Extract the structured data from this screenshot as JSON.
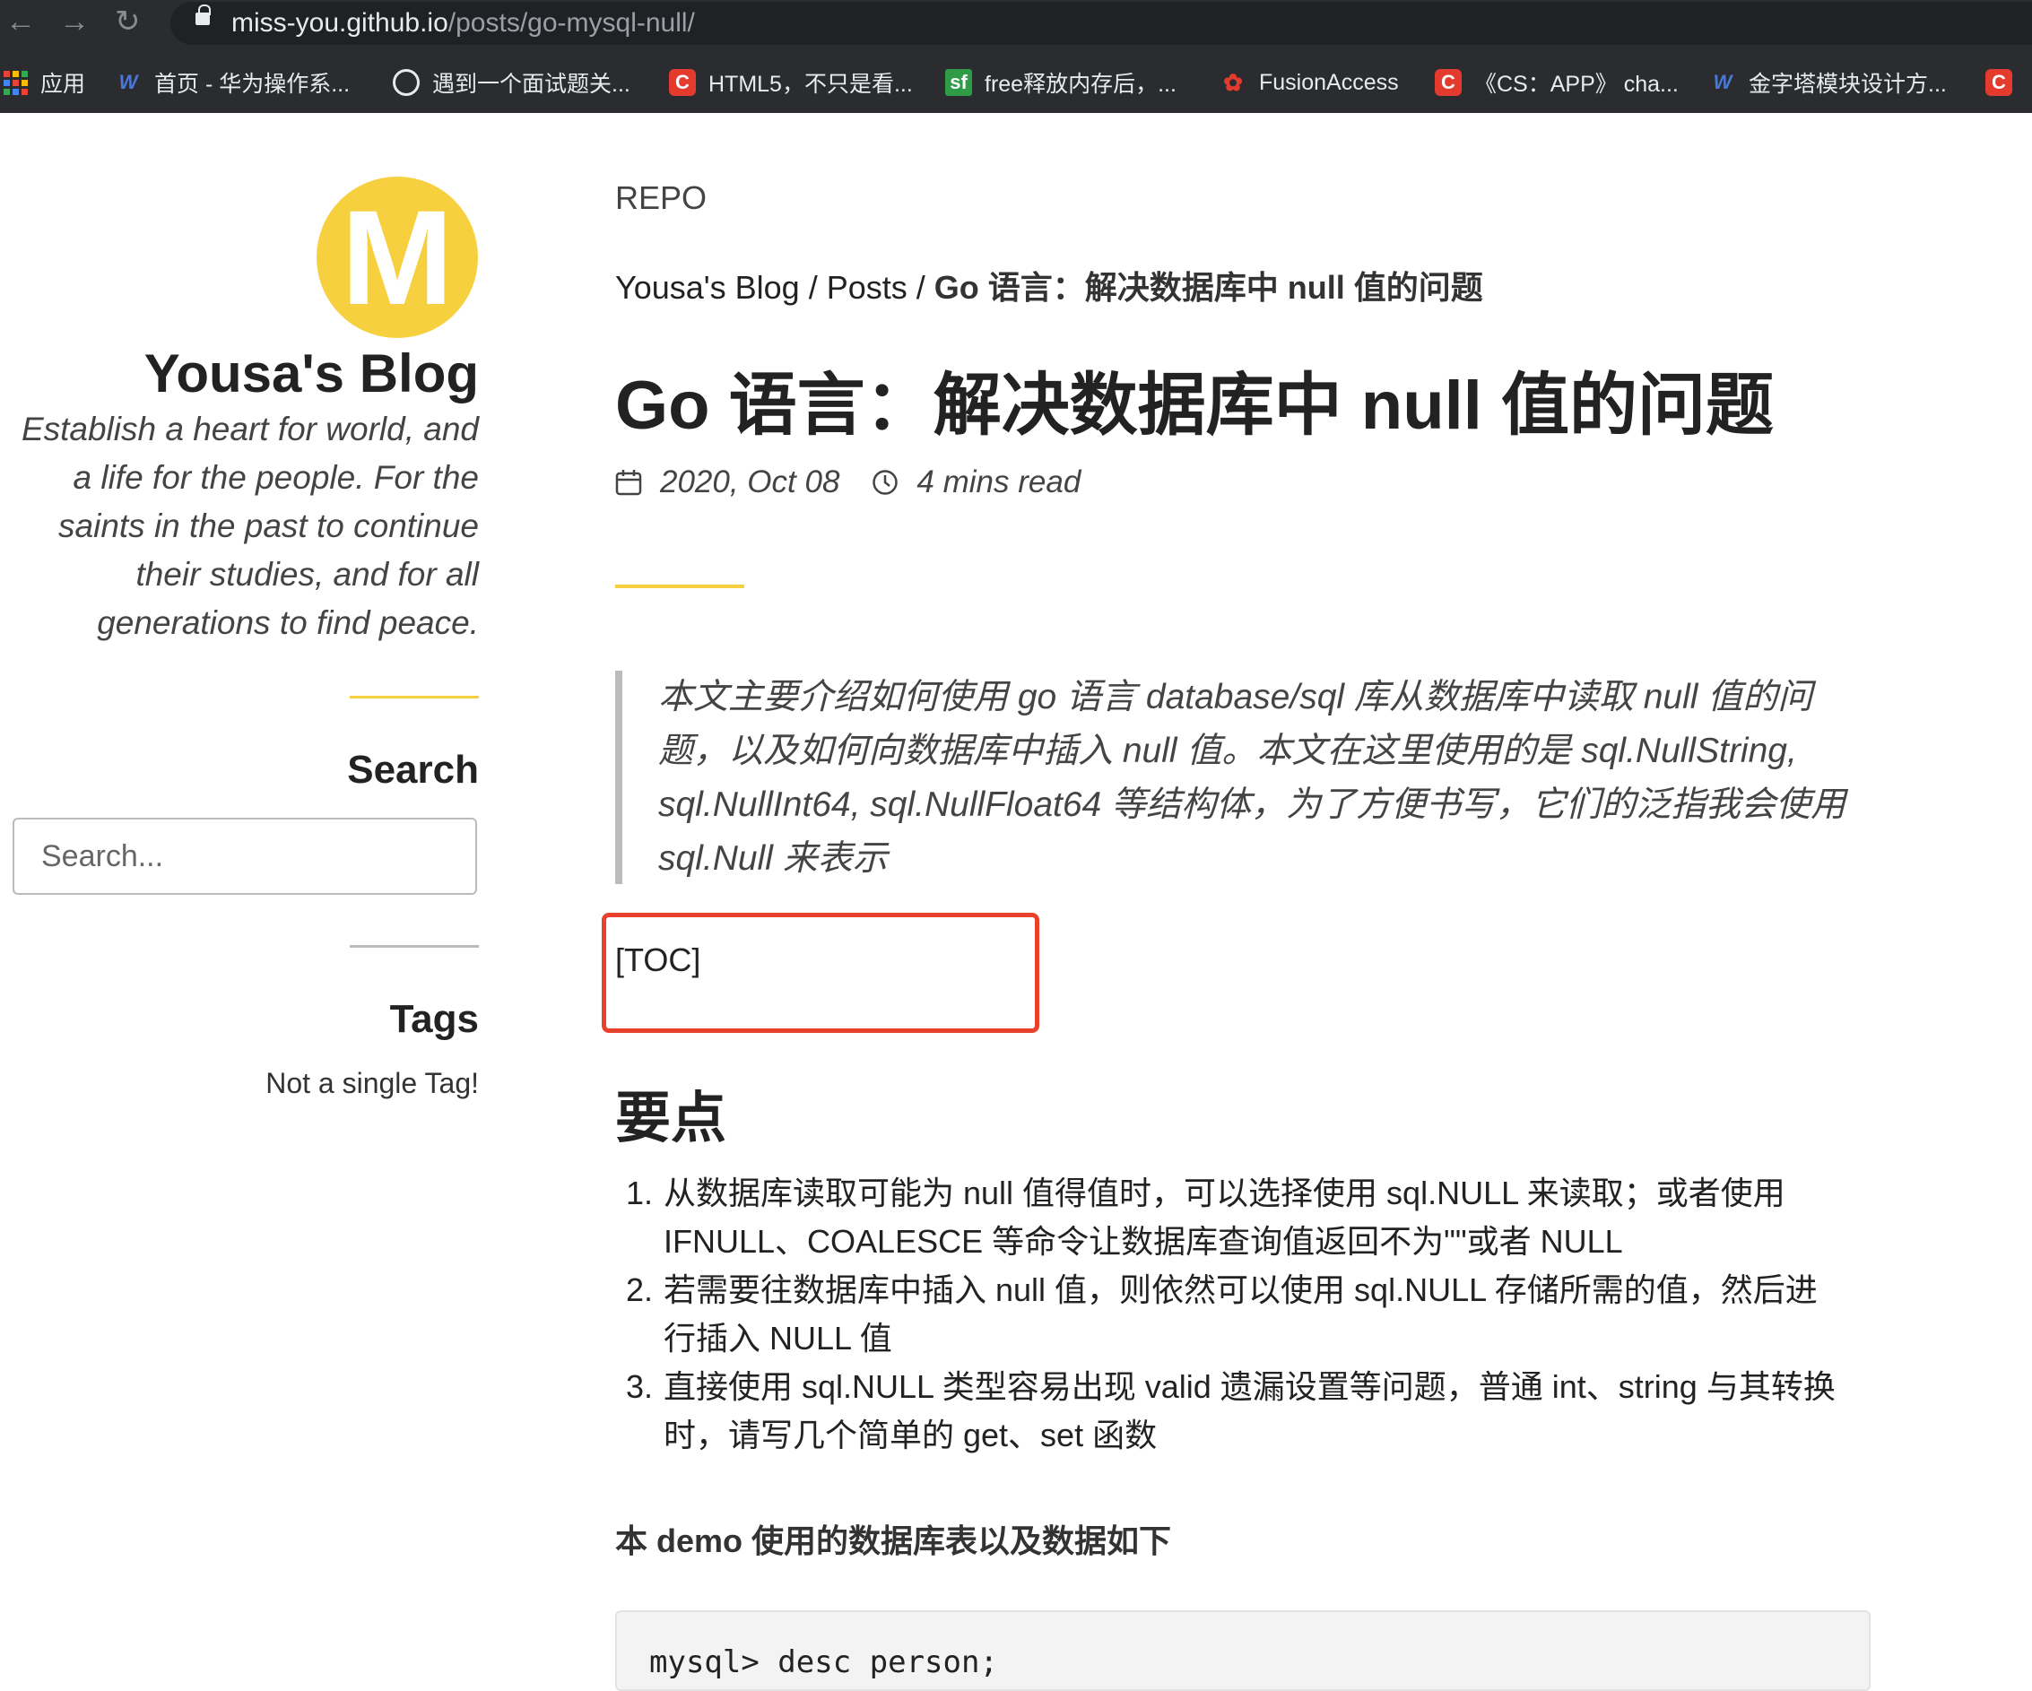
{
  "browser": {
    "url_host": "miss-you.github.io",
    "url_path": "/posts/go-mysql-null/",
    "bookmarks": [
      {
        "label": "应用",
        "icon": "apps-grid-icon"
      },
      {
        "label": "首页 - 华为操作系...",
        "icon": "huawei-wiki-icon"
      },
      {
        "label": "遇到一个面试题关...",
        "icon": "globe-icon"
      },
      {
        "label": "HTML5，不只是看...",
        "icon": "csdn-icon"
      },
      {
        "label": "free释放内存后，...",
        "icon": "segmentfault-icon"
      },
      {
        "label": "FusionAccess",
        "icon": "huawei-logo-icon"
      },
      {
        "label": "《CS：APP》 cha...",
        "icon": "csdn-icon"
      },
      {
        "label": "金字塔模块设计方...",
        "icon": "huawei-wiki-icon"
      }
    ]
  },
  "sidebar": {
    "logo_letter": "M",
    "blog_title": "Yousa's Blog",
    "tagline": "Establish a heart for world, and a life for the people. For the saints in the past to continue their studies, and for all generations to find peace.",
    "search_heading": "Search",
    "search_placeholder": "Search...",
    "tags_heading": "Tags",
    "tags_empty": "Not a single Tag!"
  },
  "main": {
    "repo_link": "REPO",
    "breadcrumb": {
      "home": "Yousa's Blog",
      "sep1": " / ",
      "posts": "Posts",
      "sep2": " / ",
      "current": "Go 语言：解决数据库中 null 值的问题"
    },
    "title": "Go 语言：解决数据库中 null 值的问题",
    "date": "2020, Oct 08",
    "read_time": "4 mins read",
    "quote": "本文主要介绍如何使用 go 语言 database/sql 库从数据库中读取 null 值的问题，以及如何向数据库中插入 null 值。本文在这里使用的是 sql.NullString, sql.NullInt64, sql.NullFloat64 等结构体，为了方便书写，它们的泛指我会使用 sql.Null 来表示",
    "toc": "[TOC]",
    "section_heading": "要点",
    "points": [
      {
        "num": "1.",
        "text": "从数据库读取可能为 null 值得值时，可以选择使用 sql.NULL 来读取；或者使用 IFNULL、COALESCE 等命令让数据库查询值返回不为\"\"或者 NULL"
      },
      {
        "num": "2.",
        "text": "若需要往数据库中插入 null 值，则依然可以使用 sql.NULL 存储所需的值，然后进行插入 NULL 值"
      },
      {
        "num": "3.",
        "text": "直接使用 sql.NULL 类型容易出现 valid 遗漏设置等问题，普通 int、string 与其转换时，请写几个简单的 get、set 函数"
      }
    ],
    "demo_heading": "本 demo 使用的数据库表以及数据如下",
    "code": "mysql> desc person;"
  },
  "colors": {
    "accent_yellow": "#f6d03f",
    "rule_gray": "#bbbbbb",
    "highlight_red": "#e8412c"
  }
}
